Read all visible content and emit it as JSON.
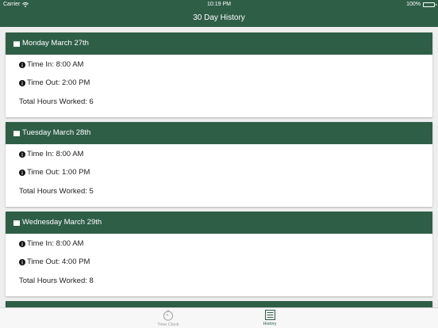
{
  "status_bar": {
    "carrier": "Carrier",
    "time": "10:19 PM",
    "battery": "100%"
  },
  "nav": {
    "title": "30 Day History"
  },
  "days": [
    {
      "date": "Monday March 27th",
      "time_in": "Time In: 8:00 AM",
      "time_out": "Time Out: 2:00 PM",
      "total": "Total Hours Worked: 6"
    },
    {
      "date": "Tuesday March 28th",
      "time_in": "Time In: 8:00 AM",
      "time_out": "Time Out: 1:00 PM",
      "total": "Total Hours Worked: 5"
    },
    {
      "date": "Wednesday March 29th",
      "time_in": "Time In: 8:00 AM",
      "time_out": "Time Out: 4:00 PM",
      "total": "Total Hours Worked: 8"
    }
  ],
  "tabs": [
    {
      "label": "Time Clock",
      "icon": "stopwatch-icon",
      "active": false
    },
    {
      "label": "History",
      "icon": "list-icon",
      "active": true
    }
  ],
  "colors": {
    "header": "#2f5e47",
    "background": "#eeeeee",
    "tab_inactive": "#9a9a9a"
  }
}
